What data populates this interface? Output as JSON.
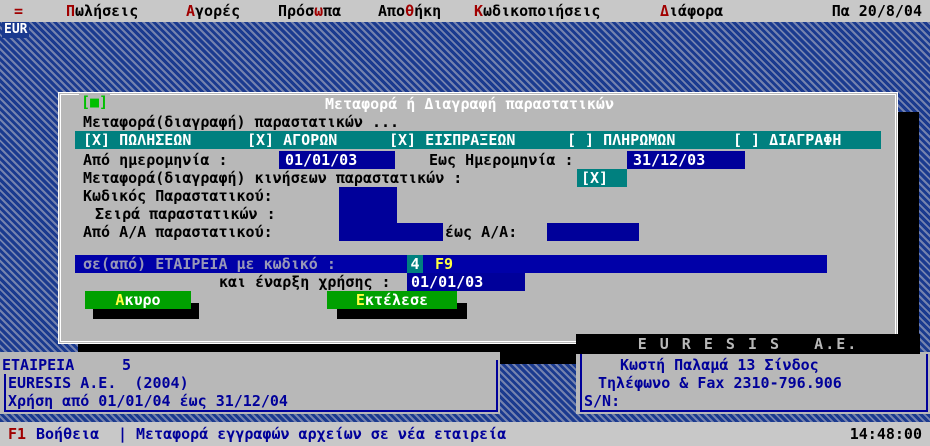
{
  "menu": {
    "equals": "=",
    "items": [
      {
        "hot": "Π",
        "rest": "ωλήσεις"
      },
      {
        "hot": "Α",
        "rest": "γορές"
      },
      {
        "hot": "",
        "rest": "Πρόσ",
        "hot2": "ω",
        "rest2": "πα"
      },
      {
        "hot": "",
        "rest": "Απο",
        "hot2": "θ",
        "rest2": "ήκη"
      },
      {
        "hot": "Κ",
        "rest": "ωδικοποιήσεις"
      },
      {
        "hot": "Δ",
        "rest": "ιάφορα"
      }
    ],
    "date": "Πα 20/8/04"
  },
  "currency": "EUR",
  "dialog": {
    "close_marker": "[■]",
    "title": "Μεταφορά ή Διαγραφή παραστατικών",
    "subtitle": "Μεταφορά(διαγραφή) παραστατικών ...",
    "checks": [
      {
        "label": "[X] ΠΩΛΗΣΕΩΝ"
      },
      {
        "label": "[X] ΑΓΟΡΩΝ"
      },
      {
        "label": "[X] ΕΙΣΠΡΑΞΕΩΝ"
      },
      {
        "label": "[ ] ΠΛΗΡΩΜΩΝ"
      },
      {
        "label": "[ ] ΔΙΑΓΡΑΦΗ"
      }
    ],
    "from_date_label": "Από ημερομηνία :",
    "from_date_value": "01/01/03",
    "to_date_label": "Εως Ημερομηνία :",
    "to_date_value": "31/12/03",
    "transfer_moves_label": "Μεταφορά(διαγραφή) κινήσεων παραστατικών :",
    "transfer_moves_value": "[X]",
    "doc_code_label": "Κωδικός Παραστατικού:",
    "doc_series_label": "Σειρά παραστατικών :",
    "from_aa_label": "Από Α/Α παραστατικού:",
    "to_aa_label": "έως Α/Α:",
    "company_label": "σε(από) ΕΤΑΙΡΕΙΑ με κωδικό :",
    "company_value": "4",
    "company_hint": "F9",
    "start_use_label": "και έναρξη χρήσης :",
    "start_use_value": "01/01/03",
    "btn_cancel_hot": "Α",
    "btn_cancel_rest": "κυρο",
    "btn_exec_hot": "Ε",
    "btn_exec_rest": "κτέλεσε"
  },
  "footer_left": {
    "company_header": "ΕΤΑΙΡΕΙΑ",
    "company_num": "5",
    "company_name": "EURESIS A.E.  (2004)",
    "period": "Χρήση από 01/01/04 έως 31/12/04"
  },
  "footer_right": {
    "brand": "E U R E S I S   A.E.",
    "address": "Κωστή Παλαμά 13 Σίνδος",
    "phone": "Τηλέφωνο & Fax 2310-796.906",
    "serial": "S/N:"
  },
  "status": {
    "key": "F1",
    "help": "Βοήθεια",
    "sep": "|",
    "message": "Μεταφορά εγγραφών αρχείων σε νέα εταιρεία",
    "time": "14:48:00"
  },
  "colors": {
    "desktop": "#1a3a8f",
    "dialog": "#b8b8b8",
    "field": "#00009a",
    "teal": "#00807f",
    "button": "#00a000",
    "hotkey": "#a00000"
  }
}
